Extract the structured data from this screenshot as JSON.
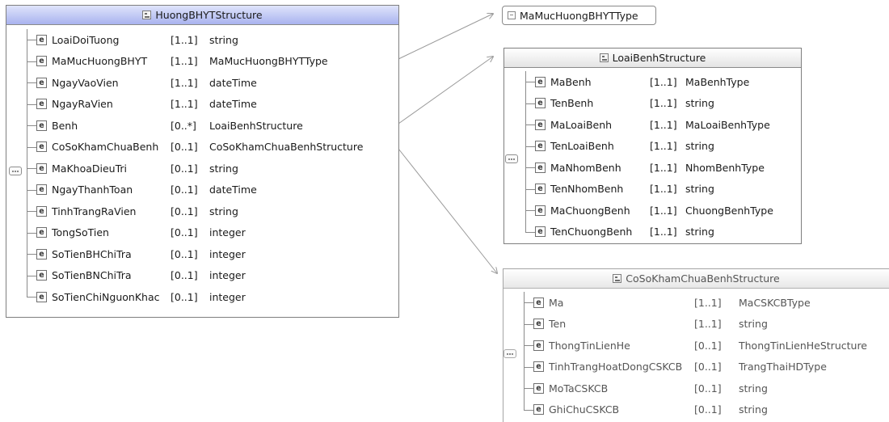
{
  "main": {
    "title": "HuongBHYTStructure",
    "rows": [
      {
        "icon": "e",
        "name": "LoaiDoiTuong",
        "mult": "[1..1]",
        "type": "string"
      },
      {
        "icon": "e",
        "name": "MaMucHuongBHYT",
        "mult": "[1..1]",
        "type": "MaMucHuongBHYTType"
      },
      {
        "icon": "e",
        "name": "NgayVaoVien",
        "mult": "[1..1]",
        "type": "dateTime"
      },
      {
        "icon": "e",
        "name": "NgayRaVien",
        "mult": "[1..1]",
        "type": "dateTime"
      },
      {
        "icon": "e",
        "name": "Benh",
        "mult": "[0..*]",
        "type": "LoaiBenhStructure"
      },
      {
        "icon": "e",
        "name": "CoSoKhamChuaBenh",
        "mult": "[0..1]",
        "type": "CoSoKhamChuaBenhStructure"
      },
      {
        "icon": "e",
        "name": "MaKhoaDieuTri",
        "mult": "[0..1]",
        "type": "string"
      },
      {
        "icon": "e",
        "name": "NgayThanhToan",
        "mult": "[0..1]",
        "type": "dateTime"
      },
      {
        "icon": "e",
        "name": "TinhTrangRaVien",
        "mult": "[0..1]",
        "type": "string"
      },
      {
        "icon": "e",
        "name": "TongSoTien",
        "mult": "[0..1]",
        "type": "integer"
      },
      {
        "icon": "e",
        "name": "SoTienBHChiTra",
        "mult": "[0..1]",
        "type": "integer"
      },
      {
        "icon": "e",
        "name": "SoTienBNChiTra",
        "mult": "[0..1]",
        "type": "integer"
      },
      {
        "icon": "e",
        "name": "SoTienChiNguonKhac",
        "mult": "[0..1]",
        "type": "integer"
      }
    ]
  },
  "simple_type": {
    "label": "MaMucHuongBHYTType"
  },
  "loai_benh": {
    "title": "LoaiBenhStructure",
    "rows": [
      {
        "icon": "e",
        "name": "MaBenh",
        "mult": "[1..1]",
        "type": "MaBenhType"
      },
      {
        "icon": "e",
        "name": "TenBenh",
        "mult": "[1..1]",
        "type": "string"
      },
      {
        "icon": "e",
        "name": "MaLoaiBenh",
        "mult": "[1..1]",
        "type": "MaLoaiBenhType"
      },
      {
        "icon": "e",
        "name": "TenLoaiBenh",
        "mult": "[1..1]",
        "type": "string"
      },
      {
        "icon": "e",
        "name": "MaNhomBenh",
        "mult": "[1..1]",
        "type": "NhomBenhType"
      },
      {
        "icon": "e",
        "name": "TenNhomBenh",
        "mult": "[1..1]",
        "type": "string"
      },
      {
        "icon": "e",
        "name": "MaChuongBenh",
        "mult": "[1..1]",
        "type": "ChuongBenhType"
      },
      {
        "icon": "e",
        "name": "TenChuongBenh",
        "mult": "[1..1]",
        "type": "string"
      }
    ]
  },
  "co_so": {
    "title": "CoSoKhamChuaBenhStructure",
    "rows": [
      {
        "icon": "e",
        "name": "Ma",
        "mult": "[1..1]",
        "type": "MaCSKCBType"
      },
      {
        "icon": "e",
        "name": "Ten",
        "mult": "[1..1]",
        "type": "string"
      },
      {
        "icon": "e",
        "name": "ThongTinLienHe",
        "mult": "[0..1]",
        "type": "ThongTinLienHeStructure"
      },
      {
        "icon": "e",
        "name": "TinhTrangHoatDongCSKCB",
        "mult": "[0..1]",
        "type": "TrangThaiHDType"
      },
      {
        "icon": "e",
        "name": "MoTaCSKCB",
        "mult": "[0..1]",
        "type": "string"
      },
      {
        "icon": "e",
        "name": "GhiChuCSKCB",
        "mult": "[0..1]",
        "type": "string"
      }
    ]
  },
  "colors": {
    "active_header_top": "#dfe4fb",
    "active_header_bottom": "#a9b3ef",
    "border": "#7f7f7f",
    "connector": "#9a9a9a"
  }
}
